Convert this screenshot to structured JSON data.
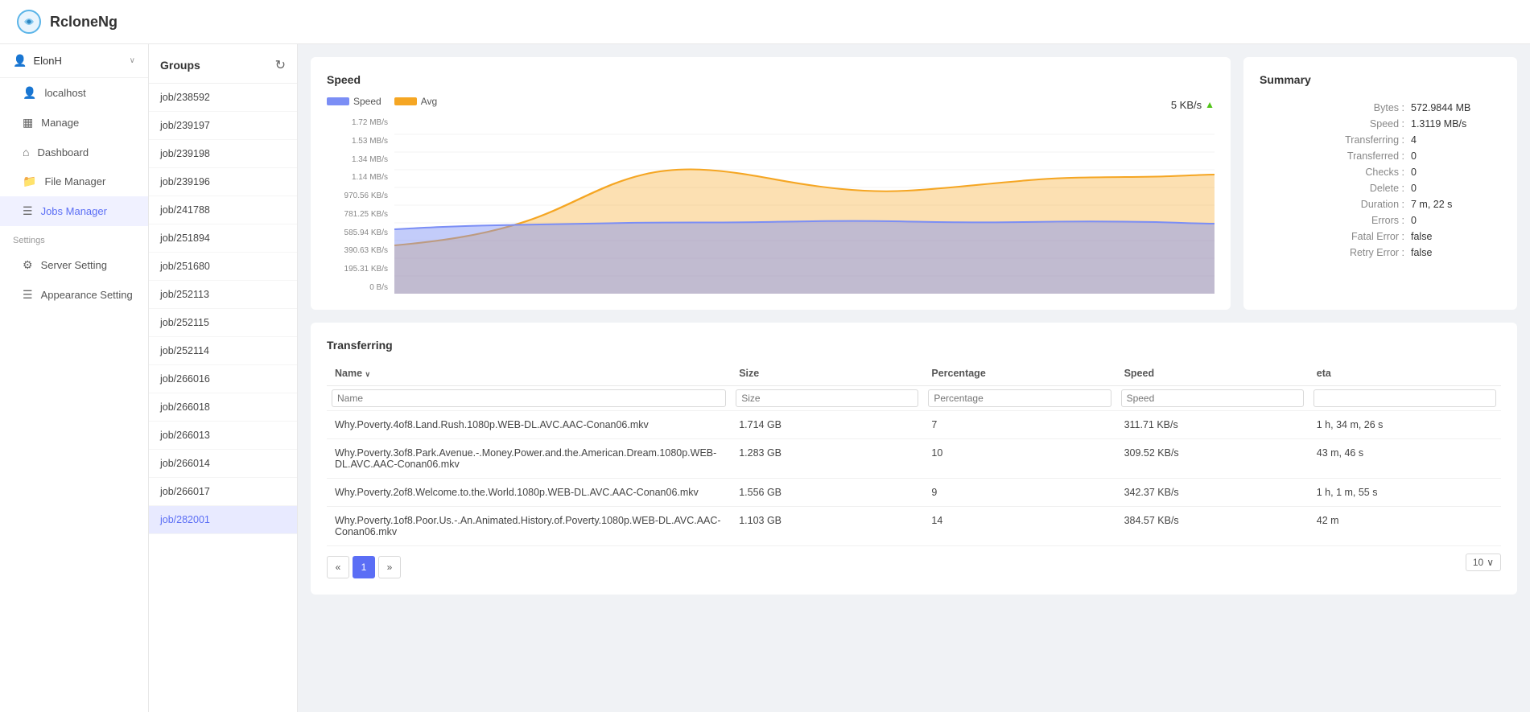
{
  "app": {
    "title": "RcloneNg"
  },
  "sidebar": {
    "user": {
      "name": "ElonH",
      "chevron": "∨"
    },
    "items": [
      {
        "id": "localhost",
        "label": "localhost",
        "icon": "👤"
      },
      {
        "id": "manage",
        "label": "Manage",
        "icon": "▦"
      },
      {
        "id": "dashboard",
        "label": "Dashboard",
        "icon": "⌂"
      },
      {
        "id": "file-manager",
        "label": "File Manager",
        "icon": "📁"
      },
      {
        "id": "jobs-manager",
        "label": "Jobs Manager",
        "icon": "☰"
      }
    ],
    "settings_label": "Settings",
    "settings_items": [
      {
        "id": "server-setting",
        "label": "Server Setting",
        "icon": "⚙"
      },
      {
        "id": "appearance-setting",
        "label": "Appearance Setting",
        "icon": "☰"
      }
    ]
  },
  "groups": {
    "title": "Groups",
    "refresh_icon": "↻",
    "items": [
      {
        "id": "job238592",
        "label": "job/238592",
        "active": false
      },
      {
        "id": "job239197",
        "label": "job/239197",
        "active": false
      },
      {
        "id": "job239198",
        "label": "job/239198",
        "active": false
      },
      {
        "id": "job239196",
        "label": "job/239196",
        "active": false
      },
      {
        "id": "job241788",
        "label": "job/241788",
        "active": false
      },
      {
        "id": "job251894",
        "label": "job/251894",
        "active": false
      },
      {
        "id": "job251680",
        "label": "job/251680",
        "active": false
      },
      {
        "id": "job252113",
        "label": "job/252113",
        "active": false
      },
      {
        "id": "job252115",
        "label": "job/252115",
        "active": false
      },
      {
        "id": "job252114",
        "label": "job/252114",
        "active": false
      },
      {
        "id": "job266016",
        "label": "job/266016",
        "active": false
      },
      {
        "id": "job266018",
        "label": "job/266018",
        "active": false
      },
      {
        "id": "job266013",
        "label": "job/266013",
        "active": false
      },
      {
        "id": "job266014",
        "label": "job/266014",
        "active": false
      },
      {
        "id": "job266017",
        "label": "job/266017",
        "active": false
      },
      {
        "id": "job282001",
        "label": "job/282001",
        "active": true
      }
    ]
  },
  "speed_chart": {
    "title": "Speed",
    "legend": {
      "speed_label": "Speed",
      "avg_label": "Avg"
    },
    "current_speed": "5 KB/s",
    "y_labels": [
      "1.53 MB/s",
      "1.34 MB/s",
      "1.14 MB/s",
      "970.56 KB/s",
      "781.25 KB/s",
      "585.94 KB/s",
      "390.63 KB/s",
      "195.31 KB/s",
      "0 B/s"
    ],
    "top_label": "1.72 MB/s"
  },
  "summary": {
    "title": "Summary",
    "rows": [
      {
        "label": "Bytes :",
        "value": "572.9844 MB"
      },
      {
        "label": "Speed :",
        "value": "1.3119 MB/s"
      },
      {
        "label": "Transferring :",
        "value": "4"
      },
      {
        "label": "Transferred :",
        "value": "0"
      },
      {
        "label": "Checks :",
        "value": "0"
      },
      {
        "label": "Delete :",
        "value": "0"
      },
      {
        "label": "Duration :",
        "value": "7 m, 22 s"
      },
      {
        "label": "Errors :",
        "value": "0"
      },
      {
        "label": "Fatal Error :",
        "value": "false"
      },
      {
        "label": "Retry Error :",
        "value": "false"
      }
    ]
  },
  "transferring": {
    "title": "Transferring",
    "columns": [
      "Name",
      "Size",
      "Percentage",
      "Speed",
      "eta"
    ],
    "filter_placeholders": [
      "Name",
      "Size",
      "Percentage",
      "Speed",
      ""
    ],
    "rows": [
      {
        "name": "Why.Poverty.4of8.Land.Rush.1080p.WEB-DL.AVC.AAC-Conan06.mkv",
        "size": "1.714 GB",
        "percentage": "7",
        "speed": "311.71 KB/s",
        "eta": "1 h, 34 m, 26 s"
      },
      {
        "name": "Why.Poverty.3of8.Park.Avenue.-.Money.Power.and.the.American.Dream.1080p.WEB-DL.AVC.AAC-Conan06.mkv",
        "size": "1.283 GB",
        "percentage": "10",
        "speed": "309.52 KB/s",
        "eta": "43 m, 46 s"
      },
      {
        "name": "Why.Poverty.2of8.Welcome.to.the.World.1080p.WEB-DL.AVC.AAC-Conan06.mkv",
        "size": "1.556 GB",
        "percentage": "9",
        "speed": "342.37 KB/s",
        "eta": "1 h, 1 m, 55 s"
      },
      {
        "name": "Why.Poverty.1of8.Poor.Us.-.An.Animated.History.of.Poverty.1080p.WEB-DL.AVC.AAC-Conan06.mkv",
        "size": "1.103 GB",
        "percentage": "14",
        "speed": "384.57 KB/s",
        "eta": "42 m"
      }
    ],
    "pagination": {
      "prev": "«",
      "current": "1",
      "next": "»",
      "page_size": "10"
    }
  }
}
